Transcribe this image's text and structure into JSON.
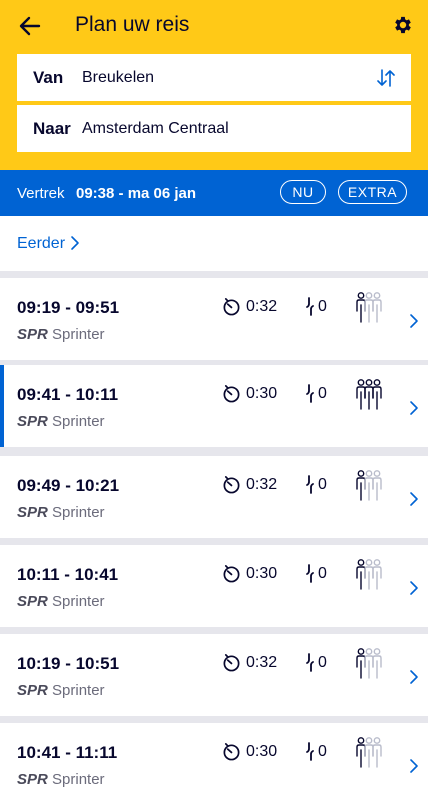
{
  "header": {
    "title": "Plan uw reis",
    "from_label": "Van",
    "from_value": "Breukelen",
    "to_label": "Naar",
    "to_value": "Amsterdam Centraal"
  },
  "departure": {
    "label": "Vertrek",
    "value": "09:38 - ma 06 jan",
    "now_button": "NU",
    "extra_button": "EXTRA"
  },
  "earlier": {
    "label": "Eerder"
  },
  "colors": {
    "brand_yellow": "#ffc917",
    "brand_blue": "#0063d3",
    "text_dark": "#07072d"
  },
  "trips": [
    {
      "times": "09:19 - 09:51",
      "type": "SPR",
      "name": "Sprinter",
      "duration": "0:32",
      "transfers": "0",
      "crowd_level": 1,
      "selected": false
    },
    {
      "times": "09:41 - 10:11",
      "type": "SPR",
      "name": "Sprinter",
      "duration": "0:30",
      "transfers": "0",
      "crowd_level": 3,
      "selected": true
    },
    {
      "times": "09:49 - 10:21",
      "type": "SPR",
      "name": "Sprinter",
      "duration": "0:32",
      "transfers": "0",
      "crowd_level": 1,
      "selected": false
    },
    {
      "times": "10:11 - 10:41",
      "type": "SPR",
      "name": "Sprinter",
      "duration": "0:30",
      "transfers": "0",
      "crowd_level": 1,
      "selected": false
    },
    {
      "times": "10:19 - 10:51",
      "type": "SPR",
      "name": "Sprinter",
      "duration": "0:32",
      "transfers": "0",
      "crowd_level": 1,
      "selected": false
    },
    {
      "times": "10:41 - 11:11",
      "type": "SPR",
      "name": "Sprinter",
      "duration": "0:30",
      "transfers": "0",
      "crowd_level": 1,
      "selected": false
    }
  ]
}
